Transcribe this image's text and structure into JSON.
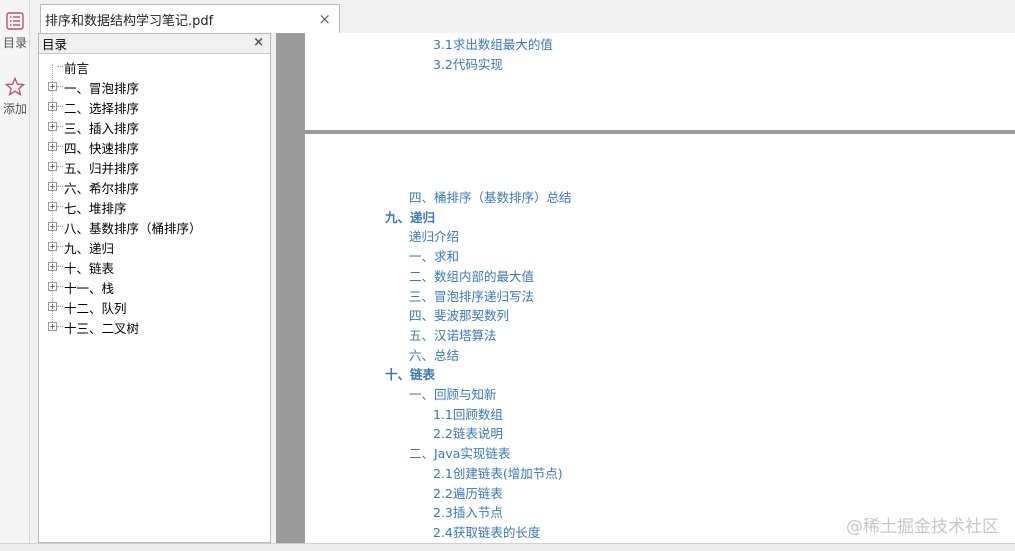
{
  "rail": {
    "outline_label": "目录",
    "add_label": "添加"
  },
  "tab": {
    "title": "排序和数据结构学习笔记.pdf",
    "close": "×"
  },
  "outline_panel": {
    "title": "目录",
    "close": "×",
    "items": [
      {
        "label": "前言",
        "expandable": false
      },
      {
        "label": "一、冒泡排序",
        "expandable": true
      },
      {
        "label": "二、选择排序",
        "expandable": true
      },
      {
        "label": "三、插入排序",
        "expandable": true
      },
      {
        "label": "四、快速排序",
        "expandable": true
      },
      {
        "label": "五、归并排序",
        "expandable": true
      },
      {
        "label": "六、希尔排序",
        "expandable": true
      },
      {
        "label": "七、堆排序",
        "expandable": true
      },
      {
        "label": "八、基数排序（桶排序）",
        "expandable": true
      },
      {
        "label": "九、递归",
        "expandable": true
      },
      {
        "label": "十、链表",
        "expandable": true
      },
      {
        "label": "十一、栈",
        "expandable": true
      },
      {
        "label": "十二、队列",
        "expandable": true
      },
      {
        "label": "十三、二叉树",
        "expandable": true
      }
    ]
  },
  "document": {
    "page1_entries": [
      {
        "text": "3.1求出数组最大的值",
        "level": 3
      },
      {
        "text": "3.2代码实现",
        "level": 3
      }
    ],
    "page2_entries": [
      {
        "text": "四、桶排序（基数排序）总结",
        "level": 2
      },
      {
        "text": "九、递归",
        "level": 1
      },
      {
        "text": "递归介绍",
        "level": 2
      },
      {
        "text": "一、求和",
        "level": 2
      },
      {
        "text": "二、数组内部的最大值",
        "level": 2
      },
      {
        "text": "三、冒泡排序递归写法",
        "level": 2
      },
      {
        "text": "四、斐波那契数列",
        "level": 2
      },
      {
        "text": "五、汉诺塔算法",
        "level": 2
      },
      {
        "text": "六、总结",
        "level": 2
      },
      {
        "text": "十、链表",
        "level": 1
      },
      {
        "text": "一、回顾与知新",
        "level": 2
      },
      {
        "text": "1.1回顾数组",
        "level": 3
      },
      {
        "text": "2.2链表说明",
        "level": 3
      },
      {
        "text": "二、Java实现链表",
        "level": 2
      },
      {
        "text": "2.1创建链表(增加节点)",
        "level": 3
      },
      {
        "text": "2.2遍历链表",
        "level": 3
      },
      {
        "text": "2.3插入节点",
        "level": 3
      },
      {
        "text": "2.4获取链表的长度",
        "level": 3
      }
    ],
    "link_color": "#3b78b8"
  },
  "watermark": "@稀土掘金技术社区"
}
